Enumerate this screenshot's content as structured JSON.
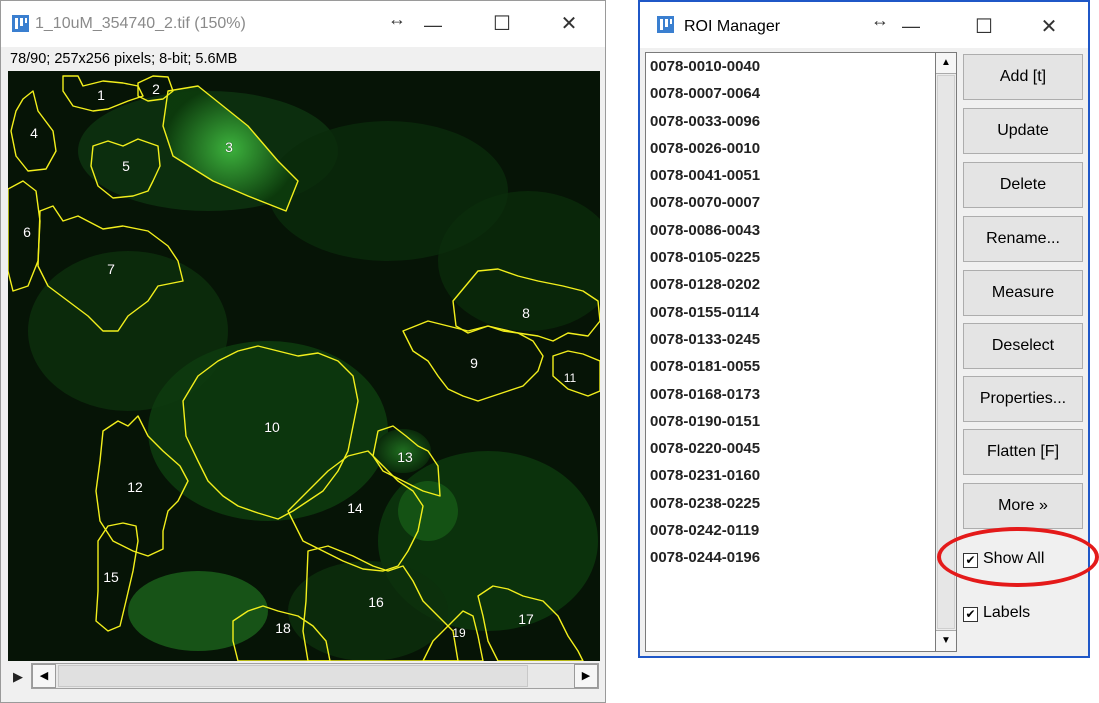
{
  "image_window": {
    "title": "1_10uM_354740_2.tif (150%)",
    "info": "78/90; 257x256 pixels; 8-bit; 5.6MB",
    "roi_labels": [
      "1",
      "2",
      "3",
      "4",
      "5",
      "6",
      "7",
      "8",
      "9",
      "10",
      "11",
      "12",
      "13",
      "14",
      "15",
      "16",
      "17",
      "18",
      "19"
    ],
    "roi_outline_color": "#f2ef1c",
    "play_icon": "play-icon"
  },
  "roi_manager": {
    "title": "ROI Manager",
    "items": [
      "0078-0010-0040",
      "0078-0007-0064",
      "0078-0033-0096",
      "0078-0026-0010",
      "0078-0041-0051",
      "0078-0070-0007",
      "0078-0086-0043",
      "0078-0105-0225",
      "0078-0128-0202",
      "0078-0155-0114",
      "0078-0133-0245",
      "0078-0181-0055",
      "0078-0168-0173",
      "0078-0190-0151",
      "0078-0220-0045",
      "0078-0231-0160",
      "0078-0238-0225",
      "0078-0242-0119",
      "0078-0244-0196"
    ],
    "buttons": {
      "add": "Add [t]",
      "update": "Update",
      "delete": "Delete",
      "rename": "Rename...",
      "measure": "Measure",
      "deselect": "Deselect",
      "properties": "Properties...",
      "flatten": "Flatten [F]",
      "more": "More »"
    },
    "show_all": {
      "label": "Show All",
      "checked": true
    },
    "labels": {
      "label": "Labels",
      "checked": true
    }
  },
  "colors": {
    "highlight_circle": "#e41a1a",
    "window_border": "#1f57c7"
  }
}
